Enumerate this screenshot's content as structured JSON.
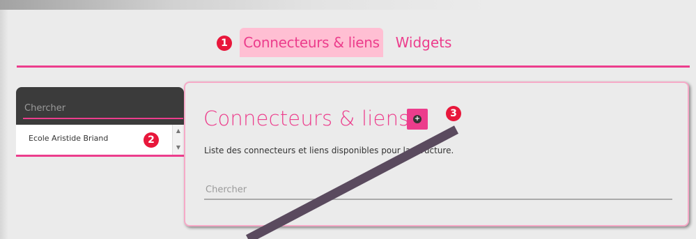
{
  "tabs": {
    "items": [
      {
        "label": "Connecteurs & liens",
        "active": true
      },
      {
        "label": "Widgets",
        "active": false
      }
    ]
  },
  "badges": {
    "b1": "1",
    "b2": "2",
    "b3": "3"
  },
  "sidebar": {
    "search_placeholder": "Chercher",
    "items": [
      {
        "label": "Ecole Aristide Briand"
      }
    ]
  },
  "main": {
    "title": "Connecteurs & liens",
    "description": "Liste des connecteurs et liens disponibles pour la structure.",
    "search_placeholder": "Chercher"
  },
  "colors": {
    "accent": "#ec3d8c",
    "active_tab_bg": "#ffbfd3",
    "badge": "#e8173b",
    "dark_panel": "#3b3b3b",
    "slash": "#5a4a5e"
  },
  "icons": {
    "add": "plus-circle-icon",
    "scroll_up": "caret-up-icon",
    "scroll_down": "caret-down-icon"
  }
}
